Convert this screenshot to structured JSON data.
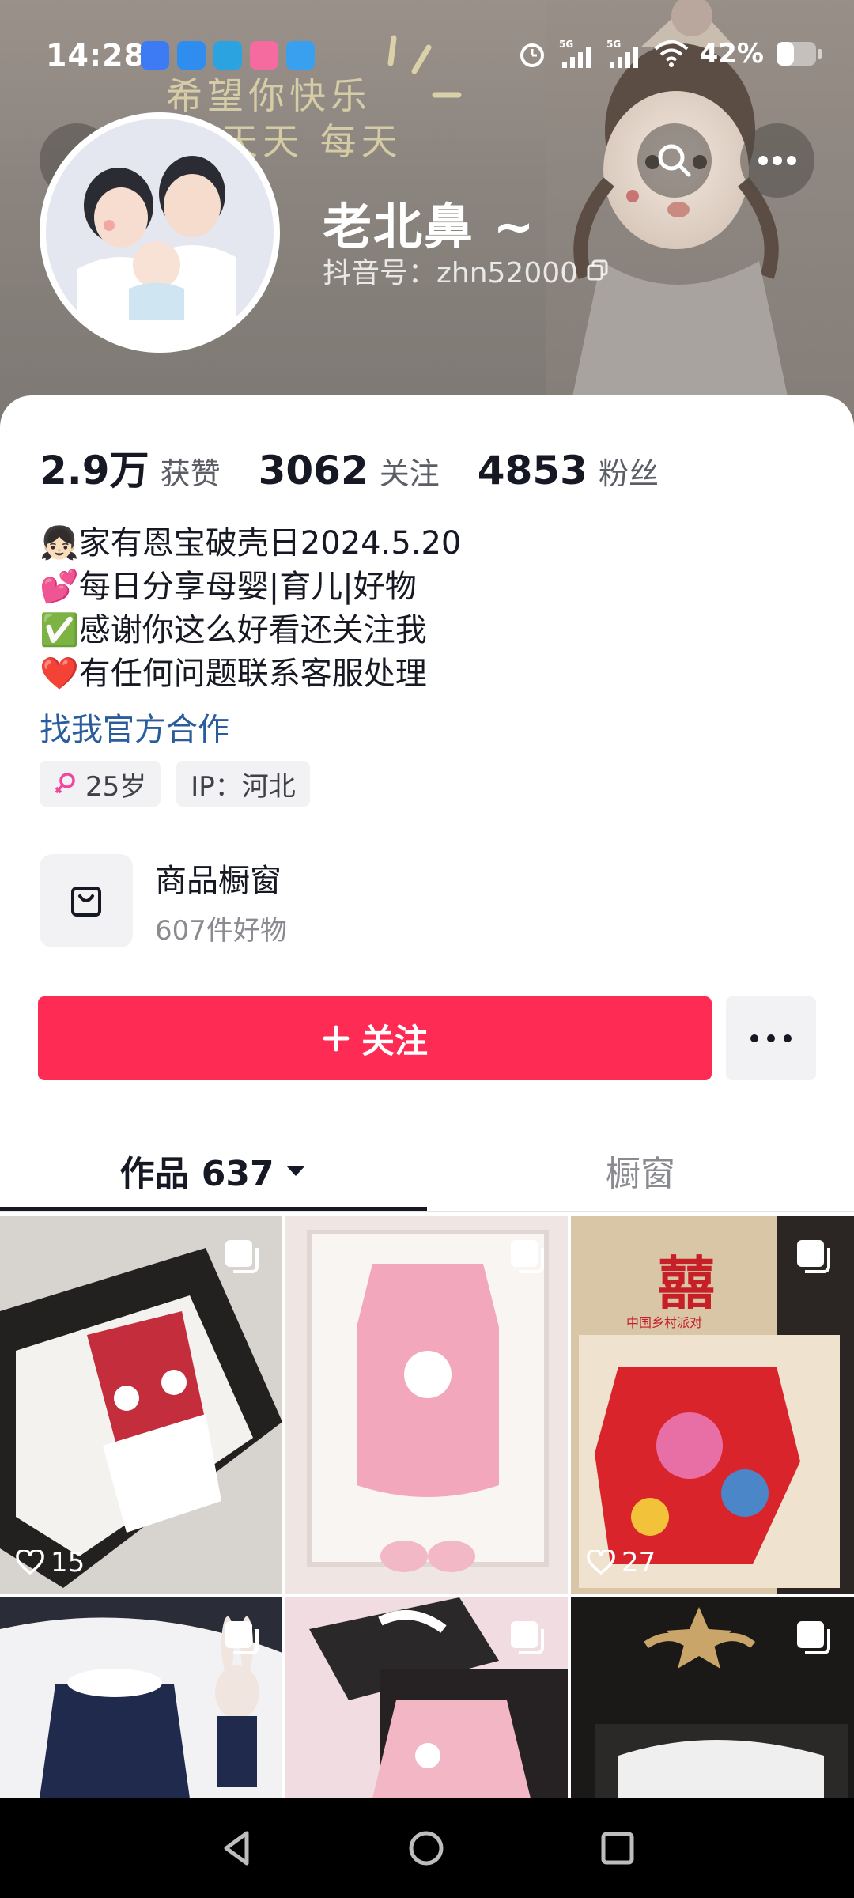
{
  "status_bar": {
    "time": "14:28",
    "battery": "42%"
  },
  "header": {
    "banner_line1": "希望你快乐",
    "banner_line2": "天天 每天",
    "username": "老北鼻 ~",
    "douyin_id": "抖音号：zhn52000"
  },
  "stats": [
    {
      "value": "2.9万",
      "label": "获赞"
    },
    {
      "value": "3062",
      "label": "关注"
    },
    {
      "value": "4853",
      "label": "粉丝"
    }
  ],
  "bio": {
    "lines": [
      "👧🏻家有恩宝破壳日2024.5.20",
      "💕每日分享母婴|育儿|好物",
      "✅感谢你这么好看还关注我",
      " ❤️有任何问题联系客服处理"
    ],
    "cooperation_link": "找我官方合作"
  },
  "tags": {
    "age": "25岁",
    "ip": "IP：河北"
  },
  "shop": {
    "title": "商品橱窗",
    "subtitle": "607件好物"
  },
  "actions": {
    "follow_label": "关注"
  },
  "tabs": {
    "works": "作品 637",
    "window": "橱窗"
  },
  "grid": {
    "tiles": [
      {
        "likes": "15"
      },
      {
        "likes": ""
      },
      {
        "likes": "27"
      },
      {
        "likes": ""
      },
      {
        "likes": ""
      },
      {
        "likes": ""
      }
    ],
    "tile_stamp_text": "囍",
    "tile_stamp_caption": "中国乡村派对"
  },
  "colors": {
    "accent": "#fe2c55",
    "link": "#2a5d9b",
    "header_bg": "#8c857f"
  }
}
